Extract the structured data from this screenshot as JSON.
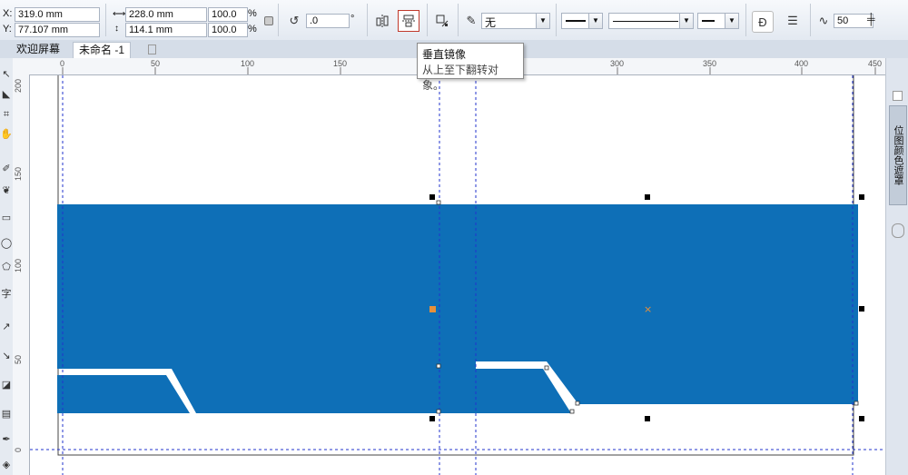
{
  "propbar": {
    "x_label": "X:",
    "x_value": "319.0 mm",
    "y_label": "Y:",
    "y_value": "77.107 mm",
    "width_value": "228.0 mm",
    "height_value": "114.1 mm",
    "scale_x": "100.0",
    "scale_y": "100.0",
    "percent_symbol": "%",
    "rotation_value": ".0",
    "degree_symbol": "°",
    "outline_value": "无",
    "smoothing_value": "50"
  },
  "tabs": {
    "welcome": "欢迎屏幕",
    "document": "未命名 -1"
  },
  "tooltip": {
    "title": "垂直镜像",
    "description": "从上至下翻转对象。"
  },
  "ruler": {
    "h_ticks": [
      "0",
      "50",
      "100",
      "150",
      "300",
      "350",
      "400",
      "450"
    ],
    "v_ticks": [
      "200",
      "150",
      "100",
      "50",
      "0"
    ]
  },
  "dock": {
    "panel_label": "位图颜色遮罩"
  },
  "colors": {
    "shape_fill": "#0e6fb7",
    "selection_handle": "#000000",
    "guide_line": "#2233cc",
    "center_marker": "#e8903a"
  }
}
